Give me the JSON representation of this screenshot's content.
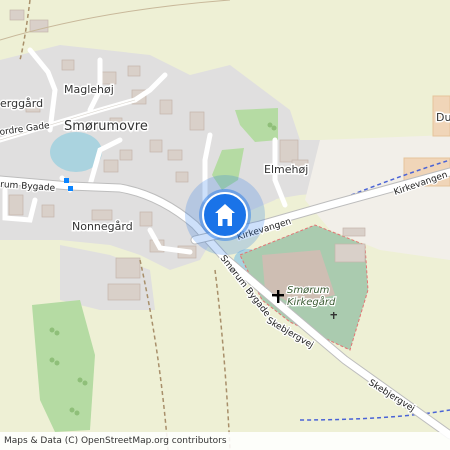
{
  "map": {
    "places": {
      "sorumovre": "Smørumovre",
      "maglehoj": "Maglehøj",
      "elmehoj": "Elmehøj",
      "nonnegard": "Nonnegård",
      "bjerggard": "erggård",
      "du": "Du"
    },
    "roads": {
      "ordre_gade": "ordre Gade",
      "rum_bygade": "rum Bygade",
      "kirkevangen": "Kirkevangen",
      "kirkevangen_east": "Kirkevangen",
      "smorum_bygade": "Smørum Bygade",
      "skebjergvej": "Skebjergvej",
      "skebjergvej_east": "Skebjergvej"
    },
    "cemetery": {
      "line1": "Smørum",
      "line2": "Kirkegård"
    },
    "marker": {
      "icon": "home-icon",
      "color": "#1a73e8"
    },
    "colors": {
      "land": "#f2efe9",
      "residential": "#e0dfdf",
      "farmland": "#eef0d5",
      "grass": "#b5dba3",
      "water": "#aad3df",
      "cemetery": "#aacbaf"
    }
  },
  "attribution": "Maps & Data (C) OpenStreetMap.org contributors"
}
